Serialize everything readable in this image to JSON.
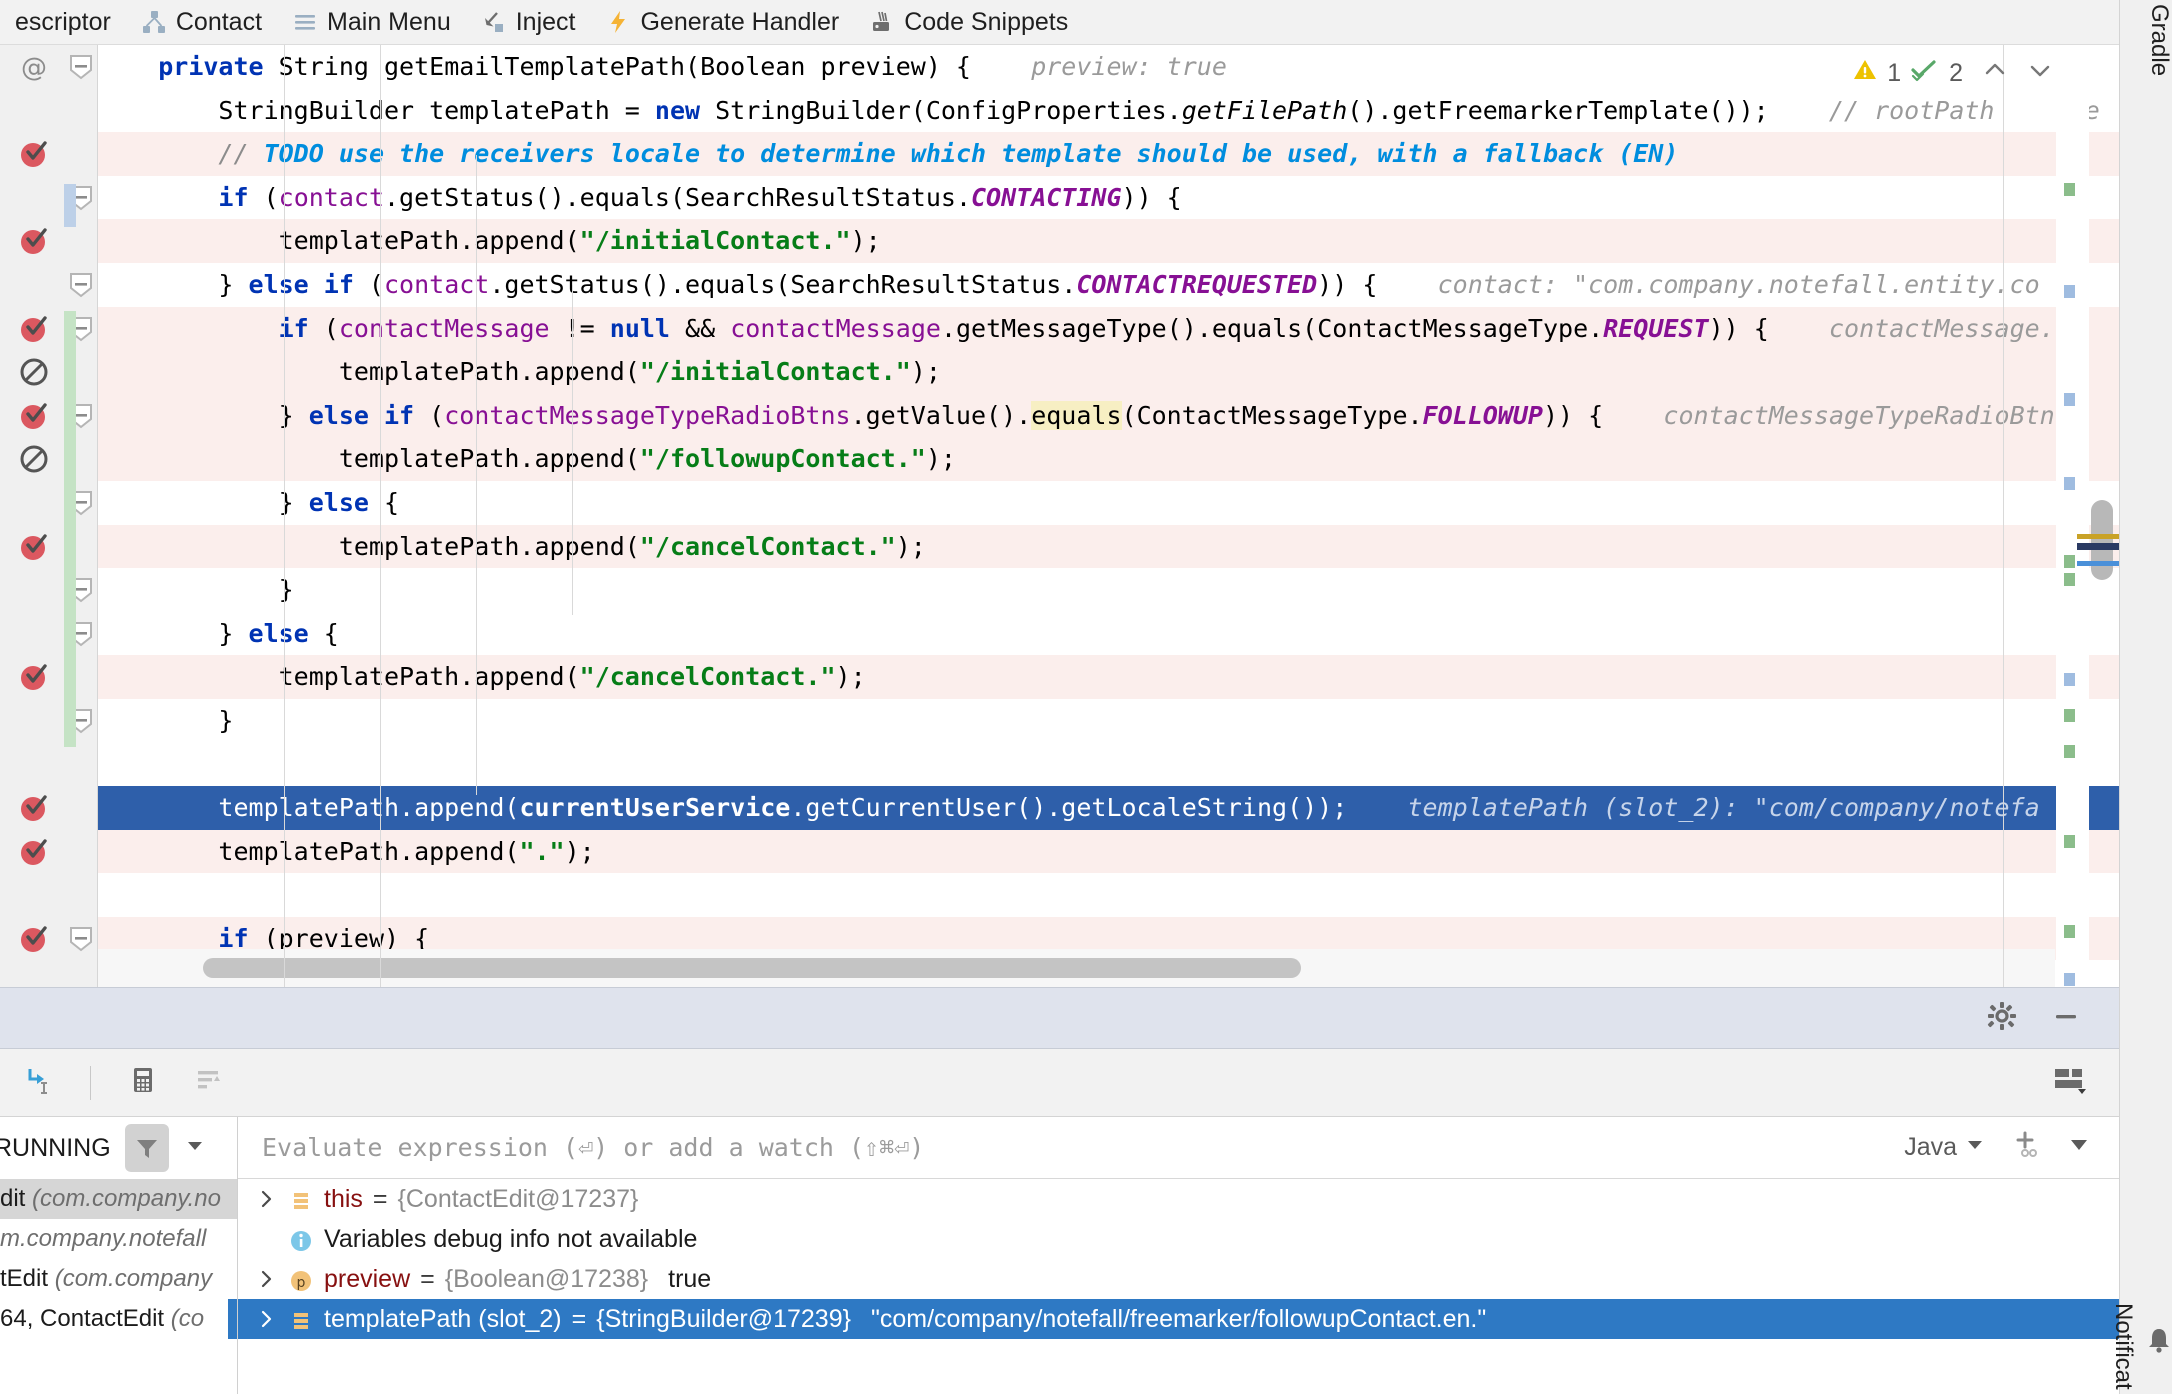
{
  "toolbar": {
    "items": [
      {
        "label": "escriptor",
        "icon": "none",
        "truncated": true
      },
      {
        "label": "Contact",
        "icon": "diagram-icon"
      },
      {
        "label": "Main Menu",
        "icon": "hamburger-icon"
      },
      {
        "label": "Inject",
        "icon": "inject-arrow-icon"
      },
      {
        "label": "Generate Handler",
        "icon": "lightning-bolt-icon"
      },
      {
        "label": "Code Snippets",
        "icon": "code-snippets-icon"
      }
    ]
  },
  "editor": {
    "inspections": {
      "warning_count": "1",
      "ok_count": "2",
      "prev_label": "^",
      "next_label": "v"
    },
    "lines": [
      {
        "id": "l1",
        "bg": "none",
        "gutter": "at-annotation",
        "fold": "collapse",
        "segments": [
          {
            "t": "    ",
            "c": "plain"
          },
          {
            "t": "private",
            "c": "kw"
          },
          {
            "t": " String getEmailTemplatePath(Boolean preview) {",
            "c": "plain"
          }
        ],
        "hint": "preview: true"
      },
      {
        "id": "l2",
        "bg": "none",
        "gutter": "none",
        "fold": "none",
        "segments": [
          {
            "t": "        StringBuilder templatePath = ",
            "c": "plain"
          },
          {
            "t": "new",
            "c": "kw"
          },
          {
            "t": " StringBuilder(ConfigProperties.",
            "c": "plain"
          },
          {
            "t": "getFilePath",
            "c": "mth"
          },
          {
            "t": "().getFreemarkerTemplate());",
            "c": "plain"
          }
        ],
        "hint": "// rootPath     te"
      },
      {
        "id": "l3",
        "bg": "warn",
        "gutter": "breakpoint-verified",
        "fold": "none",
        "segments": [
          {
            "t": "        ",
            "c": "plain"
          },
          {
            "t": "//",
            "c": "cmt"
          },
          {
            "t": " TODO use the receivers locale to determine which template should be used, with a fallback (EN)",
            "c": "todo"
          }
        ],
        "hint": ""
      },
      {
        "id": "l4",
        "bg": "none",
        "gutter": "none",
        "fold": "collapse",
        "segments": [
          {
            "t": "        ",
            "c": "plain"
          },
          {
            "t": "if",
            "c": "kw"
          },
          {
            "t": " (",
            "c": "plain"
          },
          {
            "t": "contact",
            "c": "fld"
          },
          {
            "t": ".getStatus().equals(SearchResultStatus.",
            "c": "plain"
          },
          {
            "t": "CONTACTING",
            "c": "stat"
          },
          {
            "t": ")) {",
            "c": "plain"
          }
        ],
        "hint": ""
      },
      {
        "id": "l5",
        "bg": "warn",
        "gutter": "breakpoint-verified",
        "fold": "none",
        "segments": [
          {
            "t": "            templatePath.append(",
            "c": "plain"
          },
          {
            "t": "\"/initialContact.\"",
            "c": "str"
          },
          {
            "t": ");",
            "c": "plain"
          }
        ],
        "hint": ""
      },
      {
        "id": "l6",
        "bg": "none",
        "gutter": "none",
        "fold": "collapse",
        "segments": [
          {
            "t": "        } ",
            "c": "plain"
          },
          {
            "t": "else if",
            "c": "kw"
          },
          {
            "t": " (",
            "c": "plain"
          },
          {
            "t": "contact",
            "c": "fld"
          },
          {
            "t": ".getStatus().equals(SearchResultStatus.",
            "c": "plain"
          },
          {
            "t": "CONTACTREQUESTED",
            "c": "stat"
          },
          {
            "t": ")) {",
            "c": "plain"
          }
        ],
        "hint": "contact: \"com.company.notefall.entity.co"
      },
      {
        "id": "l7",
        "bg": "warn",
        "gutter": "breakpoint-verified",
        "fold": "collapse",
        "segments": [
          {
            "t": "            ",
            "c": "plain"
          },
          {
            "t": "if",
            "c": "kw"
          },
          {
            "t": " (",
            "c": "plain"
          },
          {
            "t": "contactMessage",
            "c": "fld"
          },
          {
            "t": " != ",
            "c": "plain"
          },
          {
            "t": "null",
            "c": "kw"
          },
          {
            "t": " && ",
            "c": "plain"
          },
          {
            "t": "contactMessage",
            "c": "fld"
          },
          {
            "t": ".getMessageType().equals(ContactMessageType.",
            "c": "plain"
          },
          {
            "t": "REQUEST",
            "c": "stat"
          },
          {
            "t": ")) {",
            "c": "plain"
          }
        ],
        "hint": "contactMessage."
      },
      {
        "id": "l8",
        "bg": "warn",
        "gutter": "breakpoint-muted",
        "fold": "none",
        "segments": [
          {
            "t": "                templatePath.append(",
            "c": "plain"
          },
          {
            "t": "\"/initialContact.\"",
            "c": "str"
          },
          {
            "t": ");",
            "c": "plain"
          }
        ],
        "hint": ""
      },
      {
        "id": "l9",
        "bg": "warn",
        "gutter": "breakpoint-verified",
        "fold": "collapse",
        "segments": [
          {
            "t": "            } ",
            "c": "plain"
          },
          {
            "t": "else if",
            "c": "kw"
          },
          {
            "t": " (",
            "c": "plain"
          },
          {
            "t": "contactMessageTypeRadioBtns",
            "c": "fld"
          },
          {
            "t": ".getValue().",
            "c": "plain"
          },
          {
            "t": "equals",
            "c": "hl"
          },
          {
            "t": "(ContactMessageType.",
            "c": "plain"
          },
          {
            "t": "FOLLOWUP",
            "c": "stat"
          },
          {
            "t": ")) {",
            "c": "plain"
          }
        ],
        "hint": "contactMessageTypeRadioBtn"
      },
      {
        "id": "l10",
        "bg": "warn",
        "gutter": "breakpoint-muted",
        "fold": "none",
        "segments": [
          {
            "t": "                templatePath.append(",
            "c": "plain"
          },
          {
            "t": "\"/followupContact.\"",
            "c": "str"
          },
          {
            "t": ");",
            "c": "plain"
          }
        ],
        "hint": ""
      },
      {
        "id": "l11",
        "bg": "none",
        "gutter": "none",
        "fold": "collapse",
        "segments": [
          {
            "t": "            } ",
            "c": "plain"
          },
          {
            "t": "else",
            "c": "kw"
          },
          {
            "t": " {",
            "c": "plain"
          }
        ],
        "hint": ""
      },
      {
        "id": "l12",
        "bg": "warn",
        "gutter": "breakpoint-verified",
        "fold": "none",
        "segments": [
          {
            "t": "                templatePath.append(",
            "c": "plain"
          },
          {
            "t": "\"/cancelContact.\"",
            "c": "str"
          },
          {
            "t": ");",
            "c": "plain"
          }
        ],
        "hint": ""
      },
      {
        "id": "l13",
        "bg": "none",
        "gutter": "none",
        "fold": "collapse",
        "segments": [
          {
            "t": "            }",
            "c": "plain"
          }
        ],
        "hint": ""
      },
      {
        "id": "l14",
        "bg": "none",
        "gutter": "none",
        "fold": "collapse",
        "segments": [
          {
            "t": "        } ",
            "c": "plain"
          },
          {
            "t": "else",
            "c": "kw"
          },
          {
            "t": " {",
            "c": "plain"
          }
        ],
        "hint": ""
      },
      {
        "id": "l15",
        "bg": "warn",
        "gutter": "breakpoint-verified",
        "fold": "none",
        "segments": [
          {
            "t": "            templatePath.append(",
            "c": "plain"
          },
          {
            "t": "\"/cancelContact.\"",
            "c": "str"
          },
          {
            "t": ");",
            "c": "plain"
          }
        ],
        "hint": ""
      },
      {
        "id": "l16",
        "bg": "none",
        "gutter": "none",
        "fold": "collapse",
        "segments": [
          {
            "t": "        }",
            "c": "plain"
          }
        ],
        "hint": ""
      },
      {
        "id": "l17",
        "bg": "none",
        "gutter": "none",
        "fold": "none",
        "segments": [
          {
            "t": "",
            "c": "plain"
          }
        ],
        "hint": ""
      },
      {
        "id": "l18",
        "bg": "cursor",
        "gutter": "breakpoint-verified",
        "fold": "none",
        "segments": [
          {
            "t": "        templatePath.append(",
            "c": "plain"
          },
          {
            "t": "currentUserService",
            "c": "fld"
          },
          {
            "t": ".getCurrentUser().getLocaleString());",
            "c": "plain"
          }
        ],
        "hint": "templatePath (slot_2): \"com/company/notefa"
      },
      {
        "id": "l19",
        "bg": "warn",
        "gutter": "breakpoint-verified",
        "fold": "none",
        "segments": [
          {
            "t": "        templatePath.append(",
            "c": "plain"
          },
          {
            "t": "\".\"",
            "c": "str"
          },
          {
            "t": ");",
            "c": "plain"
          }
        ],
        "hint": ""
      },
      {
        "id": "l20",
        "bg": "none",
        "gutter": "none",
        "fold": "none",
        "segments": [
          {
            "t": "",
            "c": "plain"
          }
        ],
        "hint": ""
      },
      {
        "id": "l21",
        "bg": "warn",
        "gutter": "breakpoint-verified",
        "fold": "collapse",
        "segments": [
          {
            "t": "        ",
            "c": "plain"
          },
          {
            "t": "if",
            "c": "kw"
          },
          {
            "t": " (preview) {",
            "c": "plain"
          }
        ],
        "hint": ""
      }
    ]
  },
  "debug": {
    "header": {
      "settings_icon": "gear-icon",
      "minimize_icon": "minimize-icon"
    },
    "toolbar": {
      "restore_layout_icon": "restore-frame-icon",
      "evaluate_icon": "calculator-icon",
      "sort_icon": "sort-values-icon",
      "layout_settings_icon": "layout-settings-icon"
    },
    "frames": {
      "status": "RUNNING",
      "filter_icon": "filter-icon",
      "dropdown_icon": "chevron-down-icon",
      "rows": [
        {
          "name": "dit",
          "pkg": "(com.company.no",
          "selected": true
        },
        {
          "name": "",
          "pkg": "m.company.notefall",
          "selected": false
        },
        {
          "name": "tEdit",
          "pkg": "(com.company",
          "selected": false
        },
        {
          "name": "64, ContactEdit",
          "pkg": "(co",
          "selected": false
        }
      ]
    },
    "evaluate": {
      "placeholder": "Evaluate expression (⏎) or add a watch (⇧⌘⏎)",
      "language": "Java",
      "language_chevron": "chevron-down-icon",
      "add_watch_icon": "add-watch-icon",
      "more_icon": "chevron-down-icon"
    },
    "variables": [
      {
        "arrow": "chevron-right-icon",
        "icon": "field-icon",
        "name": "this",
        "eq": " = ",
        "value": "{ContactEdit@17237}",
        "extra": "",
        "selected": false,
        "expandable": true
      },
      {
        "arrow": "",
        "icon": "info-icon",
        "name": "",
        "eq": "",
        "value": "",
        "extra": "Variables debug info not available",
        "selected": false,
        "expandable": false
      },
      {
        "arrow": "chevron-right-icon",
        "icon": "parameter-icon",
        "name": "preview",
        "eq": " = ",
        "value": "{Boolean@17238}",
        "extra": "true",
        "selected": false,
        "expandable": true
      },
      {
        "arrow": "chevron-right-icon",
        "icon": "field-icon",
        "name": "templatePath (slot_2)",
        "eq": " = ",
        "value": "{StringBuilder@17239}",
        "extra": "\"com/company/notefall/freemarker/followupContact.en.\"",
        "selected": true,
        "expandable": true
      }
    ]
  },
  "right_strip": {
    "top_tab": {
      "label": "Gradle",
      "icon": "gradle-icon"
    },
    "bottom_tab": {
      "label": "Notificat",
      "icon": "bell-icon"
    }
  },
  "colors": {
    "selection_blue": "#2e79c4",
    "cursor_line_blue": "#2e5faa",
    "warning_bg": "#fbeeec",
    "breakpoint_red": "#db5860",
    "accent_yellow": "#edc200",
    "ok_green": "#59a869"
  }
}
